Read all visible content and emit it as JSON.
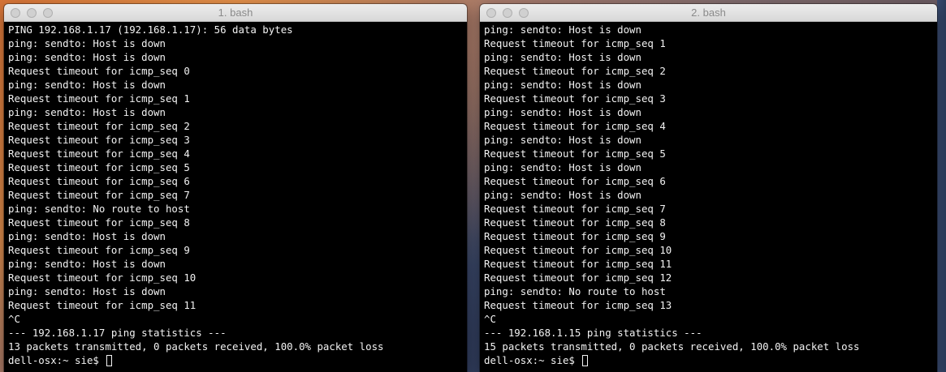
{
  "windows": [
    {
      "title": "1. bash",
      "lines": [
        "PING 192.168.1.17 (192.168.1.17): 56 data bytes",
        "ping: sendto: Host is down",
        "ping: sendto: Host is down",
        "Request timeout for icmp_seq 0",
        "ping: sendto: Host is down",
        "Request timeout for icmp_seq 1",
        "ping: sendto: Host is down",
        "Request timeout for icmp_seq 2",
        "Request timeout for icmp_seq 3",
        "Request timeout for icmp_seq 4",
        "Request timeout for icmp_seq 5",
        "Request timeout for icmp_seq 6",
        "Request timeout for icmp_seq 7",
        "ping: sendto: No route to host",
        "Request timeout for icmp_seq 8",
        "ping: sendto: Host is down",
        "Request timeout for icmp_seq 9",
        "ping: sendto: Host is down",
        "Request timeout for icmp_seq 10",
        "ping: sendto: Host is down",
        "Request timeout for icmp_seq 11",
        "^C",
        "--- 192.168.1.17 ping statistics ---",
        "13 packets transmitted, 0 packets received, 100.0% packet loss"
      ],
      "prompt": "dell-osx:~ sie$ "
    },
    {
      "title": "2. bash",
      "lines": [
        "ping: sendto: Host is down",
        "Request timeout for icmp_seq 1",
        "ping: sendto: Host is down",
        "Request timeout for icmp_seq 2",
        "ping: sendto: Host is down",
        "Request timeout for icmp_seq 3",
        "ping: sendto: Host is down",
        "Request timeout for icmp_seq 4",
        "ping: sendto: Host is down",
        "Request timeout for icmp_seq 5",
        "ping: sendto: Host is down",
        "Request timeout for icmp_seq 6",
        "ping: sendto: Host is down",
        "Request timeout for icmp_seq 7",
        "Request timeout for icmp_seq 8",
        "Request timeout for icmp_seq 9",
        "Request timeout for icmp_seq 10",
        "Request timeout for icmp_seq 11",
        "Request timeout for icmp_seq 12",
        "ping: sendto: No route to host",
        "Request timeout for icmp_seq 13",
        "^C",
        "--- 192.168.1.15 ping statistics ---",
        "15 packets transmitted, 0 packets received, 100.0% packet loss"
      ],
      "prompt": "dell-osx:~ sie$ "
    }
  ]
}
